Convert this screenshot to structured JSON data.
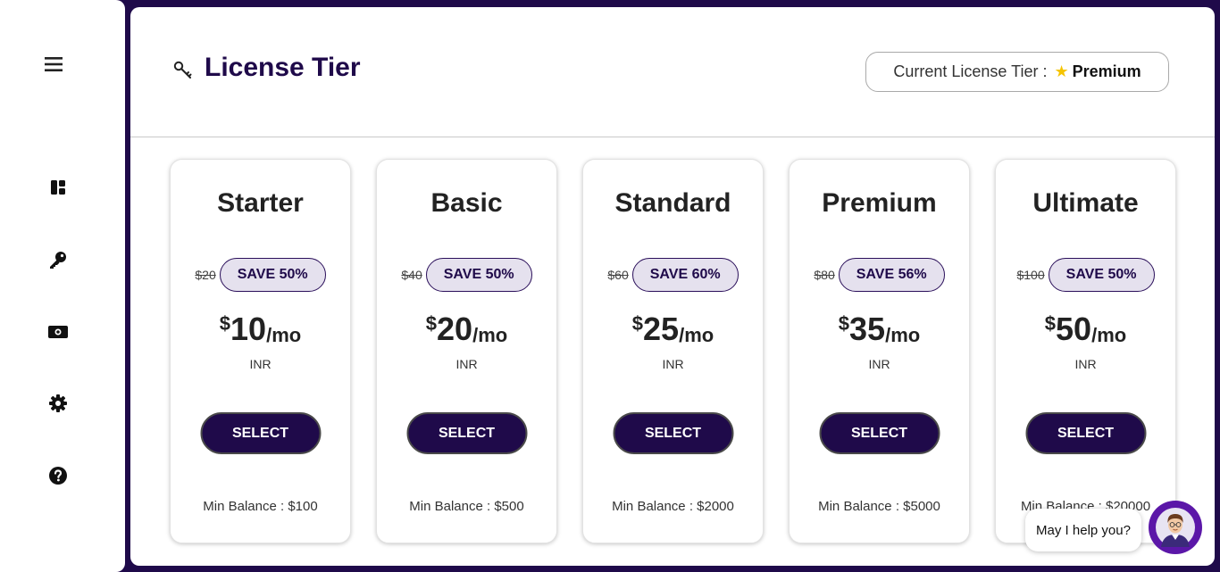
{
  "sidebar": {
    "items": [
      {
        "icon": "dashboard-icon"
      },
      {
        "icon": "key-icon"
      },
      {
        "icon": "money-icon"
      },
      {
        "icon": "gear-icon"
      },
      {
        "icon": "help-icon"
      }
    ]
  },
  "header": {
    "title": "License Tier",
    "current_tier_label": "Current License Tier :",
    "current_tier_value": "Premium"
  },
  "plans": [
    {
      "name": "Starter",
      "old_price": "$20",
      "save": "SAVE 50%",
      "currency_symbol": "$",
      "price": "10",
      "period": "/mo",
      "currency": "INR",
      "button": "SELECT",
      "min_balance": "Min Balance : $100"
    },
    {
      "name": "Basic",
      "old_price": "$40",
      "save": "SAVE 50%",
      "currency_symbol": "$",
      "price": "20",
      "period": "/mo",
      "currency": "INR",
      "button": "SELECT",
      "min_balance": "Min Balance : $500"
    },
    {
      "name": "Standard",
      "old_price": "$60",
      "save": "SAVE 60%",
      "currency_symbol": "$",
      "price": "25",
      "period": "/mo",
      "currency": "INR",
      "button": "SELECT",
      "min_balance": "Min Balance : $2000"
    },
    {
      "name": "Premium",
      "old_price": "$80",
      "save": "SAVE 56%",
      "currency_symbol": "$",
      "price": "35",
      "period": "/mo",
      "currency": "INR",
      "button": "SELECT",
      "min_balance": "Min Balance : $5000"
    },
    {
      "name": "Ultimate",
      "old_price": "$100",
      "save": "SAVE 50%",
      "currency_symbol": "$",
      "price": "50",
      "period": "/mo",
      "currency": "INR",
      "button": "SELECT",
      "min_balance": "Min Balance : $20000"
    }
  ],
  "chat": {
    "prompt": "May I help you?"
  },
  "colors": {
    "brand": "#1f0a4a",
    "badge_bg": "#e5e1ee",
    "chat_avatar_bg": "#5b17a8",
    "star": "#f5c400"
  }
}
